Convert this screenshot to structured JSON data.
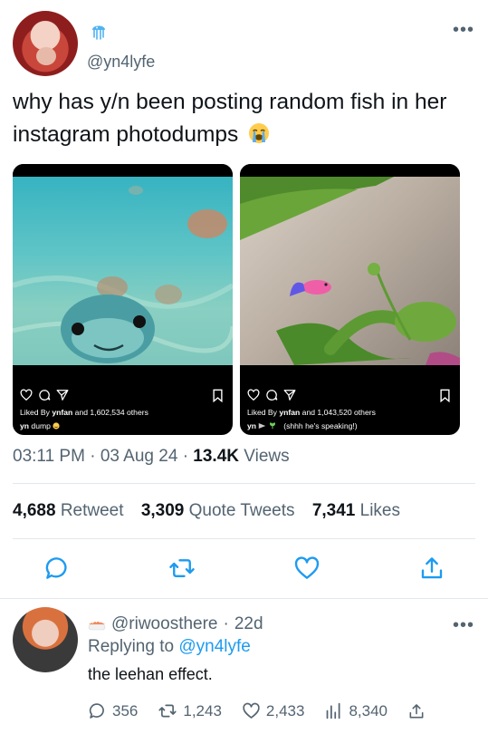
{
  "tweet": {
    "handle": "@yn4lyfe",
    "badge_icon": "jellyfish-emoji",
    "text": "why has y/n been posting random fish in her instagram photodumps",
    "text_emoji": "loudly-crying-face-emoji",
    "time": "03:11 PM",
    "date": "03 Aug 24",
    "views_count": "13.4K",
    "views_label": "Views",
    "sep": "·"
  },
  "media": {
    "left": {
      "likes_prefix": "Liked By",
      "likes_user": "ynfan",
      "likes_suffix": "and 1,602,534 others",
      "caption_user": "yn",
      "caption_text": "dump"
    },
    "right": {
      "likes_prefix": "Liked By",
      "likes_user": "ynfan",
      "likes_suffix": "and 1,043,520 others",
      "caption_user": "yn",
      "caption_text": "(shhh he's speaking!)"
    }
  },
  "stats": {
    "retweets_count": "4,688",
    "retweets_label": "Retweet",
    "quotes_count": "3,309",
    "quotes_label": "Quote Tweets",
    "likes_count": "7,341",
    "likes_label": "Likes"
  },
  "reply": {
    "handle": "@riwoosthere",
    "age": "22d",
    "sep": "·",
    "replying_prefix": "Replying to",
    "replying_handle": "@yn4lyfe",
    "text": "the leehan effect.",
    "replies": "356",
    "retweets": "1,243",
    "likes": "2,433",
    "views": "8,340"
  },
  "colors": {
    "accent": "#1d9bf0",
    "muted": "#536471",
    "text": "#0f1419",
    "divider": "#e1e8ed"
  }
}
